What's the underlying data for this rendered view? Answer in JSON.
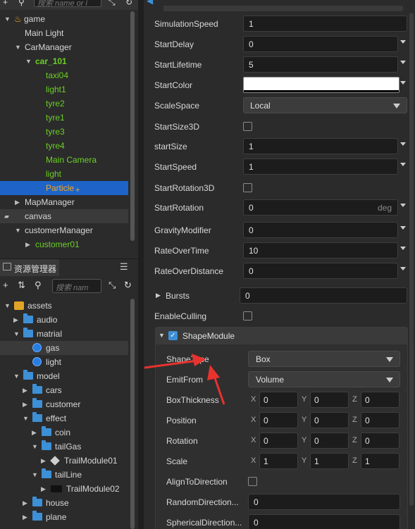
{
  "hierarchy": {
    "search_placeholder": "搜索 name or i",
    "rows": [
      {
        "label": "game",
        "indent": 0,
        "arrow": "▼",
        "color": "normal"
      },
      {
        "label": "Main Light",
        "indent": 1,
        "arrow": "",
        "color": "normal"
      },
      {
        "label": "CarManager",
        "indent": 1,
        "arrow": "▼",
        "color": "normal"
      },
      {
        "label": "car_101",
        "indent": 2,
        "arrow": "▼",
        "color": "green"
      },
      {
        "label": "taxi04",
        "indent": 3,
        "arrow": "",
        "color": "green"
      },
      {
        "label": "light1",
        "indent": 3,
        "arrow": "",
        "color": "green"
      },
      {
        "label": "tyre2",
        "indent": 3,
        "arrow": "",
        "color": "green"
      },
      {
        "label": "tyre1",
        "indent": 3,
        "arrow": "",
        "color": "green"
      },
      {
        "label": "tyre3",
        "indent": 3,
        "arrow": "",
        "color": "green"
      },
      {
        "label": "tyre4",
        "indent": 3,
        "arrow": "",
        "color": "green"
      },
      {
        "label": "Main Camera",
        "indent": 3,
        "arrow": "",
        "color": "green"
      },
      {
        "label": "light",
        "indent": 3,
        "arrow": "",
        "color": "green"
      },
      {
        "label": "Particle",
        "indent": 3,
        "arrow": "",
        "color": "orange",
        "selected": true,
        "suffix": "+"
      },
      {
        "label": "MapManager",
        "indent": 1,
        "arrow": "▶",
        "color": "normal"
      },
      {
        "label": "canvas",
        "indent": 1,
        "arrow": "",
        "color": "normal",
        "dim": true
      },
      {
        "label": "customerManager",
        "indent": 1,
        "arrow": "▼",
        "color": "normal"
      },
      {
        "label": "customer01",
        "indent": 2,
        "arrow": "▶",
        "color": "green"
      }
    ]
  },
  "assets": {
    "tab_label": "资源管理器",
    "menu_icon": "☰",
    "search_placeholder": "搜索 nam",
    "rows": [
      {
        "label": "assets",
        "indent": 0,
        "arrow": "▼",
        "icon": "assets"
      },
      {
        "label": "audio",
        "indent": 1,
        "arrow": "▶",
        "icon": "folder"
      },
      {
        "label": "matrial",
        "indent": 1,
        "arrow": "▼",
        "icon": "folder"
      },
      {
        "label": "gas",
        "indent": 2,
        "arrow": "",
        "icon": "material",
        "selected": true
      },
      {
        "label": "light",
        "indent": 2,
        "arrow": "",
        "icon": "material"
      },
      {
        "label": "model",
        "indent": 1,
        "arrow": "▼",
        "icon": "folder"
      },
      {
        "label": "cars",
        "indent": 2,
        "arrow": "▶",
        "icon": "folder"
      },
      {
        "label": "customer",
        "indent": 2,
        "arrow": "▶",
        "icon": "folder"
      },
      {
        "label": "effect",
        "indent": 2,
        "arrow": "▼",
        "icon": "folder"
      },
      {
        "label": "coin",
        "indent": 3,
        "arrow": "▶",
        "icon": "folder"
      },
      {
        "label": "tailGas",
        "indent": 3,
        "arrow": "▼",
        "icon": "folder"
      },
      {
        "label": "TrailModule01",
        "indent": 4,
        "arrow": "▶",
        "icon": "prefab"
      },
      {
        "label": "tailLine",
        "indent": 3,
        "arrow": "▼",
        "icon": "folder"
      },
      {
        "label": "TrailModule02",
        "indent": 4,
        "arrow": "▶",
        "icon": "black"
      },
      {
        "label": "house",
        "indent": 2,
        "arrow": "▶",
        "icon": "folder"
      },
      {
        "label": "plane",
        "indent": 2,
        "arrow": "▶",
        "icon": "folder"
      }
    ]
  },
  "inspector": {
    "props": [
      {
        "label": "SimulationSpeed",
        "kind": "field",
        "value": "1",
        "dropdown": false
      },
      {
        "label": "StartDelay",
        "kind": "field",
        "value": "0",
        "dropdown": true
      },
      {
        "label": "StartLifetime",
        "kind": "field",
        "value": "5",
        "dropdown": true
      },
      {
        "label": "StartColor",
        "kind": "color",
        "value": "#ffffff",
        "dropdown": true
      },
      {
        "label": "ScaleSpace",
        "kind": "select",
        "value": "Local",
        "dropdown": false
      },
      {
        "label": "StartSize3D",
        "kind": "checkbox",
        "value": "",
        "dropdown": false
      },
      {
        "label": "startSize",
        "kind": "field",
        "value": "1",
        "dropdown": true
      },
      {
        "label": "StartSpeed",
        "kind": "field",
        "value": "1",
        "dropdown": true
      },
      {
        "label": "StartRotation3D",
        "kind": "checkbox",
        "value": "",
        "dropdown": false
      },
      {
        "label": "StartRotation",
        "kind": "field",
        "value": "0",
        "unit": "deg",
        "dropdown": true
      },
      {
        "label": "GravityModifier",
        "kind": "field",
        "value": "0",
        "dropdown": true
      },
      {
        "label": "RateOverTime",
        "kind": "field",
        "value": "10",
        "dropdown": true
      },
      {
        "label": "RateOverDistance",
        "kind": "field",
        "value": "0",
        "dropdown": true
      }
    ],
    "bursts": {
      "label": "Bursts",
      "value": "0"
    },
    "enable_culling": {
      "label": "EnableCulling"
    },
    "shape_module": {
      "label": "ShapeModule",
      "shape_type": {
        "label": "ShapeType",
        "value": "Box"
      },
      "emit_from": {
        "label": "EmitFrom",
        "value": "Volume"
      },
      "vectors": [
        {
          "label": "BoxThickness",
          "x": "0",
          "y": "0",
          "z": "0"
        },
        {
          "label": "Position",
          "x": "0",
          "y": "0",
          "z": "0"
        },
        {
          "label": "Rotation",
          "x": "0",
          "y": "0",
          "z": "0"
        },
        {
          "label": "Scale",
          "x": "1",
          "y": "1",
          "z": "1"
        }
      ],
      "axis_labels": {
        "x": "X",
        "y": "Y",
        "z": "Z"
      },
      "align_to_direction": {
        "label": "AlignToDirection"
      },
      "random_direction": {
        "label": "RandomDirection...",
        "value": "0"
      },
      "spherical_direction": {
        "label": "SphericalDirection...",
        "value": "0"
      }
    }
  },
  "colors": {
    "accent": "#1e64c8",
    "green": "#6ccf26",
    "orange": "#f5a623",
    "annotation_red": "#e8322e"
  }
}
